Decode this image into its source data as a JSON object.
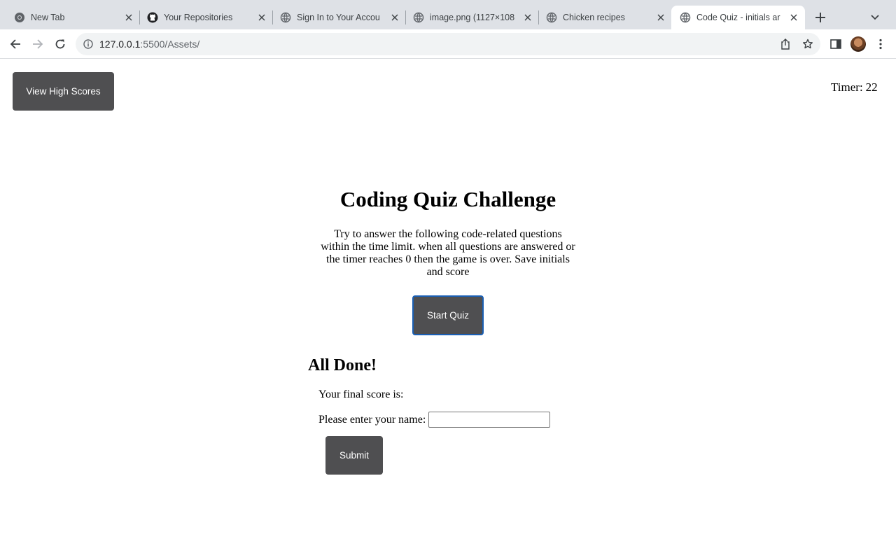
{
  "browser": {
    "tabs": [
      {
        "title": "New Tab",
        "icon": "chrome-icon",
        "active": false
      },
      {
        "title": "Your Repositories",
        "icon": "github-icon",
        "active": false
      },
      {
        "title": "Sign In to Your Accou",
        "icon": "globe-icon",
        "active": false
      },
      {
        "title": "image.png (1127×108",
        "icon": "globe-icon",
        "active": false
      },
      {
        "title": "Chicken recipes",
        "icon": "globe-icon",
        "active": false
      },
      {
        "title": "Code Quiz - initials ar",
        "icon": "globe-icon",
        "active": true
      }
    ],
    "address": {
      "host": "127.0.0.1",
      "path": ":5500/Assets/"
    },
    "colors": {
      "tabstrip": "#dee1e6",
      "omnibox": "#f1f3f4"
    }
  },
  "page": {
    "high_scores_button": "View High Scores",
    "timer_label": "Timer:",
    "timer_value": "22",
    "title": "Coding Quiz Challenge",
    "description": "Try to answer the following code-related questions within the time limit. when all questions are answered or the timer reaches 0 then the game is over. Save initials and score",
    "start_button": "Start Quiz",
    "done_title": "All Done!",
    "final_score_label": "Your final score is:",
    "final_score_value": "",
    "name_label": "Please enter your name:",
    "name_value": "",
    "submit_button": "Submit",
    "colors": {
      "button_bg": "#4f4f51",
      "button_text": "#ffffff",
      "focus_ring": "#1a5fb4"
    }
  }
}
